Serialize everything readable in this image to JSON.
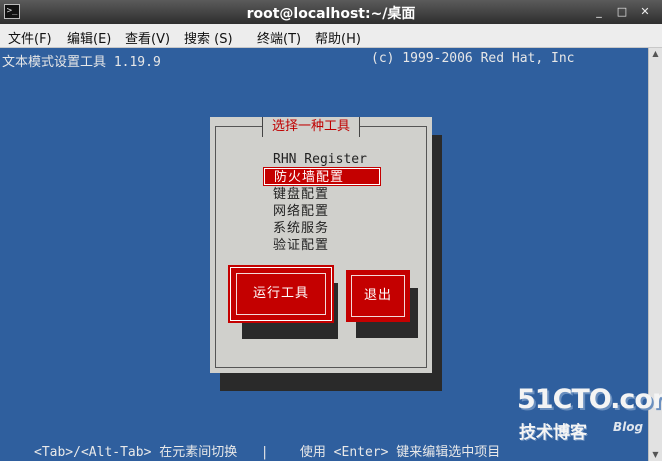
{
  "window": {
    "title": "root@localhost:~/桌面",
    "icon": "terminal-icon",
    "controls": {
      "minimize": "_",
      "maximize": "□",
      "close": "✕"
    }
  },
  "menubar": {
    "items": [
      {
        "label": "文件(F)"
      },
      {
        "label": "编辑(E)"
      },
      {
        "label": "查看(V)"
      },
      {
        "label": "搜索 (S)"
      },
      {
        "label": "终端(T)"
      },
      {
        "label": "帮助(H)"
      }
    ]
  },
  "terminal": {
    "header_left": "文本模式设置工具 1.19.9",
    "header_right": "(c) 1999-2006 Red Hat, Inc",
    "footer": "<Tab>/<Alt-Tab> 在元素间切换   |    使用 <Enter> 键来编辑选中项目"
  },
  "dialog": {
    "title": "选择一种工具",
    "items": [
      {
        "label": "RHN Register"
      },
      {
        "label": "防火墙配置"
      },
      {
        "label": "键盘配置"
      },
      {
        "label": "网络配置"
      },
      {
        "label": "系统服务"
      },
      {
        "label": "验证配置"
      }
    ],
    "selected_index": 1,
    "buttons": {
      "run": "运行工具",
      "quit": "退出"
    }
  },
  "watermark": {
    "logo": "51CTO.com",
    "subtitle": "技术博客",
    "blog": "Blog"
  },
  "colors": {
    "terminal_bg": "#2f5f9e",
    "dialog_bg": "#d0d0cc",
    "accent": "#c40000"
  }
}
